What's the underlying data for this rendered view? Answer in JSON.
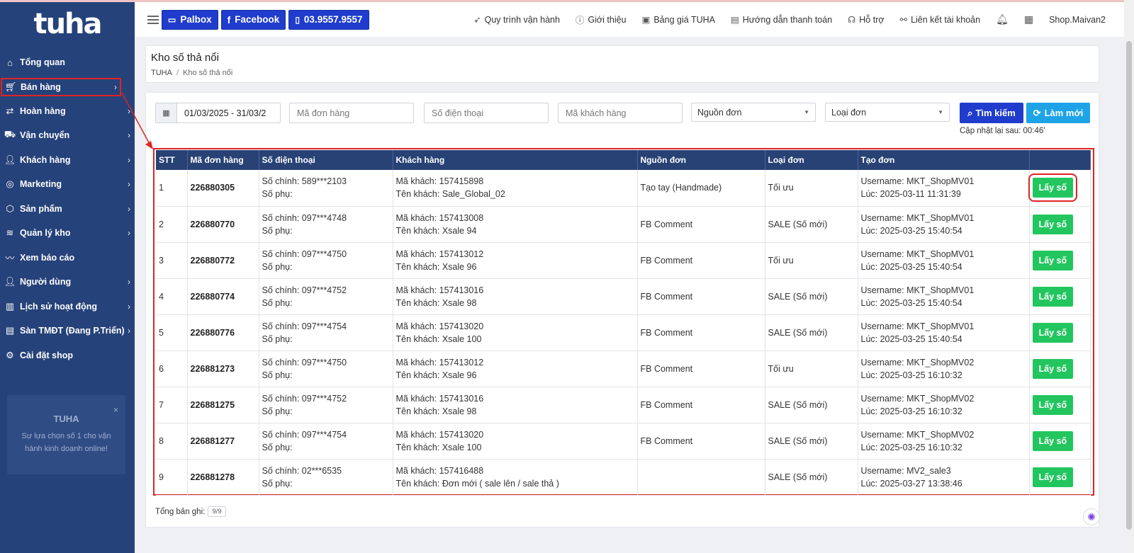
{
  "logo": "tuha",
  "sidebar": {
    "items": [
      {
        "label": "Tổng quan",
        "icon": "home-icon",
        "chevron": false
      },
      {
        "label": "Bán hàng",
        "icon": "cart-icon",
        "chevron": true
      },
      {
        "label": "Hoàn hàng",
        "icon": "return-icon",
        "chevron": true
      },
      {
        "label": "Vận chuyển",
        "icon": "truck-icon",
        "chevron": true
      },
      {
        "label": "Khách hàng",
        "icon": "users-icon",
        "chevron": true
      },
      {
        "label": "Marketing",
        "icon": "target-icon",
        "chevron": true
      },
      {
        "label": "Sản phẩm",
        "icon": "box-icon",
        "chevron": true
      },
      {
        "label": "Quản lý kho",
        "icon": "layers-icon",
        "chevron": true
      },
      {
        "label": "Xem báo cáo",
        "icon": "pulse-icon",
        "chevron": false
      },
      {
        "label": "Người dùng",
        "icon": "user-icon",
        "chevron": true
      },
      {
        "label": "Lịch sử hoạt động",
        "icon": "map-icon",
        "chevron": true
      },
      {
        "label": "Sàn TMĐT (Đang P.Triển)",
        "icon": "store-icon",
        "chevron": true
      },
      {
        "label": "Cài đặt shop",
        "icon": "gear-icon",
        "chevron": false
      }
    ],
    "promo": {
      "title": "TUHA",
      "desc": "Sự lựa chọn số 1 cho vận hành kinh doanh online!",
      "close": "×"
    }
  },
  "topbar": {
    "buttons": [
      {
        "label": "Palbox",
        "icon": "chat-icon"
      },
      {
        "label": "Facebook",
        "icon": "facebook-icon"
      },
      {
        "label": "03.9557.9557",
        "icon": "phone-icon"
      }
    ],
    "nav": [
      {
        "label": "Quy trình vận hành",
        "icon": "rocket-icon"
      },
      {
        "label": "Giới thiệu",
        "icon": "info-icon"
      },
      {
        "label": "Bảng giá TUHA",
        "icon": "gift-icon"
      },
      {
        "label": "Hướng dẫn thanh toán",
        "icon": "card-icon"
      },
      {
        "label": "Hỗ trợ",
        "icon": "headset-icon"
      },
      {
        "label": "Liên kết tài khoản",
        "icon": "link-icon"
      }
    ],
    "user": "Shop.Maivan2"
  },
  "page": {
    "title": "Kho số thả nổi",
    "breadcrumb": [
      "TUHA",
      "Kho số thả nổi"
    ]
  },
  "filters": {
    "date": "01/03/2025 - 31/03/2",
    "order_code_ph": "Mã đơn hàng",
    "phone_ph": "Số điện thoại",
    "customer_code_ph": "Mã khách hàng",
    "source": "Nguồn đơn",
    "type": "Loại đơn",
    "search": "Tìm kiếm",
    "reset": "Làm mới",
    "countdown": "Cập nhật lại sau: 00:46'"
  },
  "table": {
    "headers": [
      "STT",
      "Mã đơn hàng",
      "Số điện thoại",
      "Khách hàng",
      "Nguồn đơn",
      "Loại đơn",
      "Tạo đơn",
      ""
    ],
    "action_label": "Lấy số",
    "rows": [
      {
        "stt": "1",
        "code": "226880305",
        "phone1": "Số chính: 589***2103",
        "phone2": "Số phụ:",
        "cust1": "Mã khách: 157415898",
        "cust2": "Tên khách: Sale_Global_02",
        "source": "Tạo tay (Handmade)",
        "type": "Tối ưu",
        "created1": "Username: MKT_ShopMV01",
        "created2": "Lúc: 2025-03-11 11:31:39"
      },
      {
        "stt": "2",
        "code": "226880770",
        "phone1": "Số chính: 097***4748",
        "phone2": "Số phụ:",
        "cust1": "Mã khách: 157413008",
        "cust2": "Tên khách: Xsale 94",
        "source": "FB Comment",
        "type": "SALE (Số mới)",
        "created1": "Username: MKT_ShopMV01",
        "created2": "Lúc: 2025-03-25 15:40:54"
      },
      {
        "stt": "3",
        "code": "226880772",
        "phone1": "Số chính: 097***4750",
        "phone2": "Số phụ:",
        "cust1": "Mã khách: 157413012",
        "cust2": "Tên khách: Xsale 96",
        "source": "FB Comment",
        "type": "Tối ưu",
        "created1": "Username: MKT_ShopMV01",
        "created2": "Lúc: 2025-03-25 15:40:54"
      },
      {
        "stt": "4",
        "code": "226880774",
        "phone1": "Số chính: 097***4752",
        "phone2": "Số phụ:",
        "cust1": "Mã khách: 157413016",
        "cust2": "Tên khách: Xsale 98",
        "source": "FB Comment",
        "type": "SALE (Số mới)",
        "created1": "Username: MKT_ShopMV01",
        "created2": "Lúc: 2025-03-25 15:40:54"
      },
      {
        "stt": "5",
        "code": "226880776",
        "phone1": "Số chính: 097***4754",
        "phone2": "Số phụ:",
        "cust1": "Mã khách: 157413020",
        "cust2": "Tên khách: Xsale 100",
        "source": "FB Comment",
        "type": "SALE (Số mới)",
        "created1": "Username: MKT_ShopMV01",
        "created2": "Lúc: 2025-03-25 15:40:54"
      },
      {
        "stt": "6",
        "code": "226881273",
        "phone1": "Số chính: 097***4750",
        "phone2": "Số phụ:",
        "cust1": "Mã khách: 157413012",
        "cust2": "Tên khách: Xsale 96",
        "source": "FB Comment",
        "type": "Tối ưu",
        "created1": "Username: MKT_ShopMV02",
        "created2": "Lúc: 2025-03-25 16:10:32"
      },
      {
        "stt": "7",
        "code": "226881275",
        "phone1": "Số chính: 097***4752",
        "phone2": "Số phụ:",
        "cust1": "Mã khách: 157413016",
        "cust2": "Tên khách: Xsale 98",
        "source": "FB Comment",
        "type": "SALE (Số mới)",
        "created1": "Username: MKT_ShopMV02",
        "created2": "Lúc: 2025-03-25 16:10:32"
      },
      {
        "stt": "8",
        "code": "226881277",
        "phone1": "Số chính: 097***4754",
        "phone2": "Số phụ:",
        "cust1": "Mã khách: 157413020",
        "cust2": "Tên khách: Xsale 100",
        "source": "FB Comment",
        "type": "SALE (Số mới)",
        "created1": "Username: MKT_ShopMV02",
        "created2": "Lúc: 2025-03-25 16:10:32"
      },
      {
        "stt": "9",
        "code": "226881278",
        "phone1": "Số chính: 02***6535",
        "phone2": "Số phụ:",
        "cust1": "Mã khách: 157416488",
        "cust2": "Tên khách: Đơn mới ( sale lên / sale thả )",
        "source": "",
        "type": "SALE (Số mới)",
        "created1": "Username: MV2_sale3",
        "created2": "Lúc: 2025-03-27 13:38:46"
      }
    ]
  },
  "footer": {
    "total_label": "Tổng bản ghi:",
    "total_value": "9/9"
  },
  "colors": {
    "sidebar": "#26427a",
    "primary": "#1f3ccc",
    "accent": "#1ea3e6",
    "success": "#22c55e",
    "highlight": "#e02424",
    "table_header": "#284275"
  }
}
